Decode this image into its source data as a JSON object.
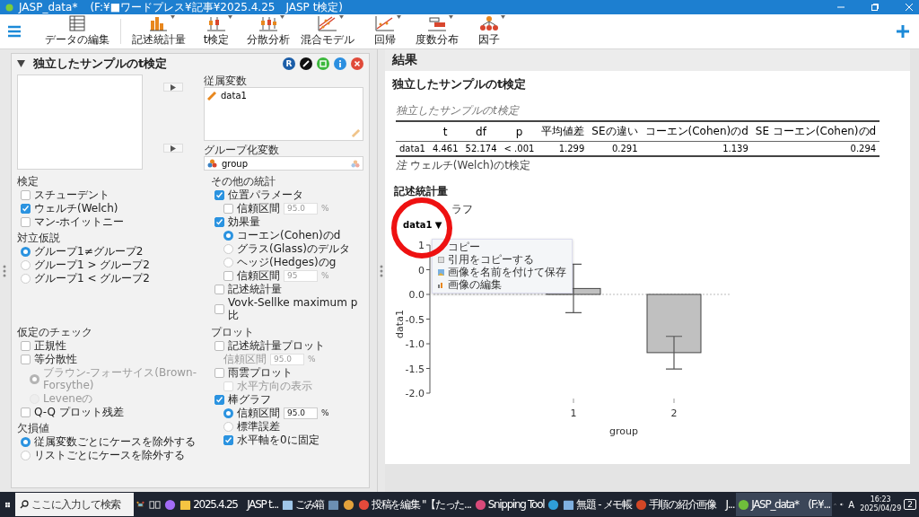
{
  "window": {
    "app": "JASP_data*",
    "path": "(F:¥■ワードプレス¥記事¥2025.4.25　JASP t検定)"
  },
  "toolbar": {
    "items": [
      {
        "kind": "table",
        "label": "データの編集",
        "menu": false
      },
      {
        "kind": "bars",
        "label": "記述統計量",
        "menu": true
      },
      {
        "kind": "ttest",
        "label": "t検定",
        "menu": true
      },
      {
        "kind": "anova",
        "label": "分散分析",
        "menu": true
      },
      {
        "kind": "mixed",
        "label": "混合モデル",
        "menu": true
      },
      {
        "kind": "regression",
        "label": "回帰",
        "menu": true
      },
      {
        "kind": "frequencies",
        "label": "度数分布",
        "menu": true
      },
      {
        "kind": "factor",
        "label": "因子",
        "menu": true
      }
    ]
  },
  "analysis": {
    "title": "独立したサンプルのt検定",
    "expanded": true,
    "r_label": "R",
    "dependent": {
      "label": "従属変数",
      "items": [
        "data1"
      ]
    },
    "grouping": {
      "label": "グループ化変数",
      "value": "group"
    },
    "option_rows": [
      {
        "left": [
          {
            "title": "検定",
            "items": [
              {
                "kind": "checkbox",
                "label": "スチューデント",
                "checked": false
              },
              {
                "kind": "checkbox",
                "label": "ウェルチ(Welch)",
                "checked": true
              },
              {
                "kind": "checkbox",
                "label": "マン-ホイットニー",
                "checked": false
              }
            ]
          },
          {
            "title": "対立仮説",
            "items": [
              {
                "kind": "radio",
                "label": "グループ1≠グループ2",
                "selected": true
              },
              {
                "kind": "radio",
                "label": "グループ1 > グループ2",
                "selected": false
              },
              {
                "kind": "radio",
                "label": "グループ1 < グループ2",
                "selected": false
              }
            ]
          }
        ],
        "right": [
          {
            "title": "その他の統計",
            "items": [
              {
                "kind": "checkbox",
                "label": "位置パラメータ",
                "checked": true,
                "children": [
                  {
                    "kind": "checkbox",
                    "label": "信頼区間",
                    "checked": false,
                    "field": {
                      "value": "95.0",
                      "unit": "%",
                      "disabled": true
                    }
                  }
                ]
              },
              {
                "kind": "checkbox",
                "label": "効果量",
                "checked": true,
                "children": [
                  {
                    "kind": "radio",
                    "label": "コーエン(Cohen)のd",
                    "selected": true
                  },
                  {
                    "kind": "radio",
                    "label": "グラス(Glass)のデルタ",
                    "selected": false
                  },
                  {
                    "kind": "radio",
                    "label": "ヘッジ(Hedges)のg",
                    "selected": false
                  },
                  {
                    "kind": "checkbox",
                    "label": "信頼区間",
                    "checked": false,
                    "field": {
                      "value": "95",
                      "unit": "%",
                      "disabled": true
                    }
                  }
                ]
              },
              {
                "kind": "checkbox",
                "label": "記述統計量",
                "checked": false
              },
              {
                "kind": "checkbox",
                "label": "Vovk-Sellke maximum p比",
                "checked": false
              }
            ]
          }
        ]
      },
      {
        "left": [
          {
            "title": "仮定のチェック",
            "items": [
              {
                "kind": "checkbox",
                "label": "正規性",
                "checked": false
              },
              {
                "kind": "checkbox",
                "label": "等分散性",
                "checked": false,
                "children": [
                  {
                    "kind": "radio",
                    "label": "ブラウン-フォーサイス(Brown-Forsythe)",
                    "selected": true,
                    "disabled": true
                  },
                  {
                    "kind": "radio",
                    "label": "Leveneの",
                    "selected": false,
                    "disabled": true
                  }
                ]
              },
              {
                "kind": "checkbox",
                "label": "Q-Q プロット残差",
                "checked": false
              }
            ]
          },
          {
            "title": "欠損値",
            "items": [
              {
                "kind": "radio",
                "label": "従属変数ごとにケースを除外する",
                "selected": true
              },
              {
                "kind": "radio",
                "label": "リストごとにケースを除外する",
                "selected": false
              }
            ]
          }
        ],
        "right": [
          {
            "title": "プロット",
            "items": [
              {
                "kind": "checkbox",
                "label": "記述統計量プロット",
                "checked": false,
                "children": [
                  {
                    "kind": "label",
                    "label": "信頼区間",
                    "disabled": true,
                    "field": {
                      "value": "95.0",
                      "unit": "%",
                      "disabled": true
                    }
                  }
                ]
              },
              {
                "kind": "checkbox",
                "label": "雨雲プロット",
                "checked": false,
                "children": [
                  {
                    "kind": "checkbox",
                    "label": "水平方向の表示",
                    "checked": false,
                    "disabled": true
                  }
                ]
              },
              {
                "kind": "checkbox",
                "label": "棒グラフ",
                "checked": true,
                "children": [
                  {
                    "kind": "radio",
                    "label": "信頼区間",
                    "selected": true,
                    "field": {
                      "value": "95.0",
                      "unit": "%",
                      "disabled": false
                    }
                  },
                  {
                    "kind": "radio",
                    "label": "標準誤差",
                    "selected": false
                  },
                  {
                    "kind": "checkbox",
                    "label": "水平軸を0に固定",
                    "checked": true
                  }
                ]
              }
            ]
          }
        ]
      }
    ]
  },
  "results": {
    "title": "結果",
    "heading": "独立したサンプルのt検定",
    "table": {
      "caption": "独立したサンプルのt検定",
      "columns": [
        "",
        "t",
        "df",
        "p",
        "平均値差",
        "SEの違い",
        "コーエン(Cohen)のd",
        "SE コーエン(Cohen)のd"
      ],
      "rows": [
        [
          "data1",
          "4.461",
          "52.174",
          "< .001",
          "1.299",
          "0.291",
          "1.139",
          "0.294"
        ]
      ],
      "note": "*注* ウェルチ(Welch)のt検定"
    },
    "descriptives": {
      "heading": "記述統計量",
      "subheading": "ラフ",
      "plot_button": "data1",
      "caret": "▼",
      "menu": [
        {
          "kind": "copy",
          "label": "コピー"
        },
        {
          "kind": "cite",
          "label": "引用をコピーする"
        },
        {
          "kind": "save",
          "label": "画像を名前を付けて保存"
        },
        {
          "kind": "edit",
          "label": "画像の編集"
        }
      ],
      "chart_data": {
        "type": "bar",
        "xlabel": "group",
        "ylabel": "data1",
        "categories": [
          "1",
          "2"
        ],
        "series": [
          {
            "color": "#c0c0c0",
            "values": [
              0.12,
              -1.18
            ],
            "errors": [
              0.49,
              0.33
            ]
          }
        ],
        "ylim": [
          -2.0,
          1.0
        ],
        "yticks": [
          {
            "value": -2,
            "label": "-2.0"
          },
          {
            "value": -1.5,
            "label": "-1.5"
          },
          {
            "value": -1,
            "label": "-1.0"
          },
          {
            "value": -0.5,
            "label": "-0.5"
          },
          {
            "value": 0,
            "label": "0.0"
          },
          {
            "value": 0.5,
            "label": "0"
          },
          {
            "value": 1,
            "label": "1"
          }
        ]
      }
    }
  },
  "taskbar": {
    "search_placeholder": "ここに入力して検索",
    "apps": [
      {
        "kind": "taskview",
        "active": false
      },
      {
        "kind": "copilot",
        "active": false
      },
      {
        "kind": "folder",
        "label": "2025.4.25　JASP t...",
        "active": false
      },
      {
        "kind": "recycle",
        "label": "ごみ箱",
        "active": false
      },
      {
        "kind": "calculator",
        "active": false
      },
      {
        "kind": "paint",
        "active": false
      },
      {
        "kind": "chrome",
        "label": "投稿を編集 \"【たった...",
        "active": false
      },
      {
        "kind": "snipping",
        "label": "Snipping Tool",
        "active": false
      },
      {
        "kind": "edge",
        "active": false
      },
      {
        "kind": "notepad",
        "label": "無題 - メモ帳",
        "active": false
      },
      {
        "kind": "powerpoint",
        "label": "手順の紹介画像　J...",
        "active": false
      },
      {
        "kind": "jasp",
        "label": "JASP_data*　(F:¥...",
        "active": true
      }
    ],
    "ime": "A",
    "time": "16:23",
    "date": "2025/04/29",
    "notifications": "2"
  }
}
